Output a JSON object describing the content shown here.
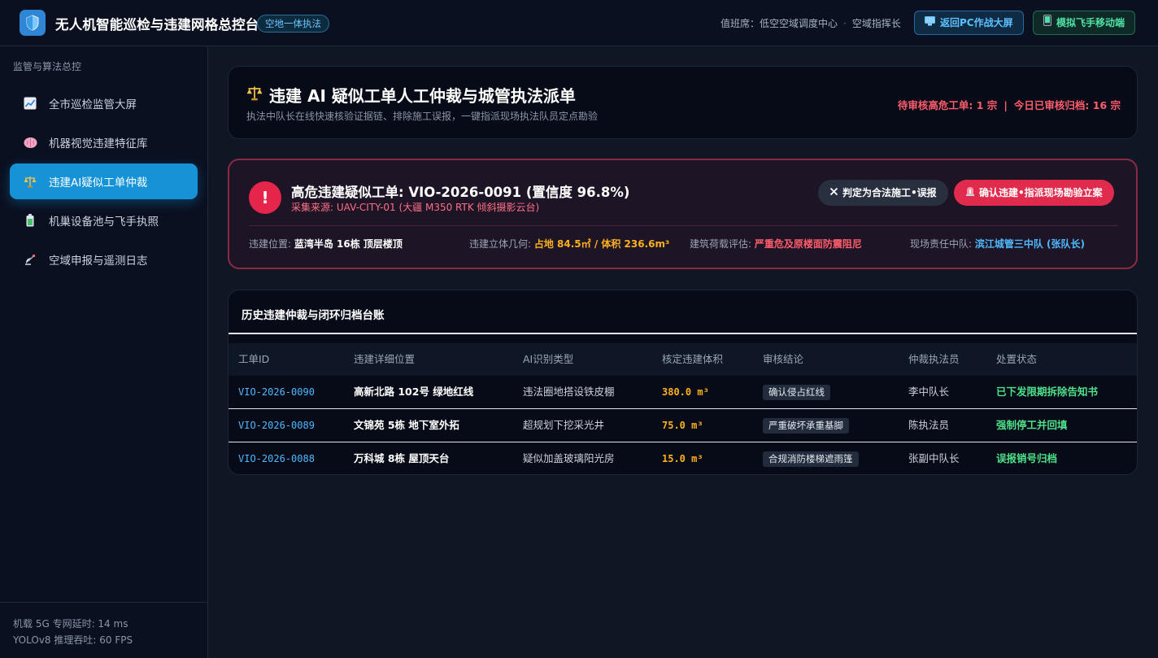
{
  "app": {
    "title": "无人机智能巡检与违建网格总控台",
    "badge": "空地一体执法",
    "duty_label": "值班席：低空空域调度中心",
    "duty_role": "空域指挥长",
    "btn_pc": "返回PC作战大屏",
    "btn_mobile": "模拟飞手移动端"
  },
  "sidebar": {
    "heading": "监管与算法总控",
    "items": [
      {
        "label": "全市巡检监管大屏",
        "icon": "chart-icon"
      },
      {
        "label": "机器视觉违建特征库",
        "icon": "brain-icon"
      },
      {
        "label": "违建AI疑似工单仲裁",
        "icon": "scales-icon",
        "active": true
      },
      {
        "label": "机巢设备池与飞手执照",
        "icon": "battery-icon"
      },
      {
        "label": "空域申报与遥测日志",
        "icon": "satellite-icon"
      }
    ],
    "footer_latency": "机载 5G 专网延时: 14 ms",
    "footer_fps": "YOLOv8 推理吞吐: 60 FPS"
  },
  "header": {
    "title": "违建 AI 疑似工单人工仲裁与城管执法派单",
    "subtitle": "执法中队长在线快速核验证据链、排除施工误报，一键指派现场执法队员定点勘验",
    "pending": "待审核高危工单: 1 宗",
    "archived": "今日已审核归档: 16 宗"
  },
  "alert": {
    "title": "高危违建疑似工单: VIO-2026-0091 (置信度 96.8%)",
    "source": "采集来源: UAV-CITY-01 (大疆 M350 RTK 倾斜摄影云台)",
    "btn_false": "判定为合法施工•误报",
    "btn_confirm": "确认违建•指派现场勘验立案",
    "fields": [
      {
        "label": "违建位置: ",
        "value": "蓝湾半岛 16栋 顶层楼顶"
      },
      {
        "label": "违建立体几何: ",
        "value": "占地 84.5㎡ / 体积 236.6m³"
      },
      {
        "label": "建筑荷载评估: ",
        "value": "严重危及原楼面防震阻尼"
      },
      {
        "label": "现场责任中队: ",
        "value": "滨江城管三中队 (张队长)"
      }
    ]
  },
  "table": {
    "title": "历史违建仲裁与闭环归档台账",
    "columns": [
      "工单ID",
      "违建详细位置",
      "AI识别类型",
      "核定违建体积",
      "审核结论",
      "仲裁执法员",
      "处置状态"
    ],
    "rows": [
      {
        "id": "VIO-2026-0090",
        "location": "高新北路 102号 绿地红线",
        "type": "违法圈地搭设铁皮棚",
        "volume": "380.0 m³",
        "verdict": "确认侵占红线",
        "officer": "李中队长",
        "status": "已下发限期拆除告知书"
      },
      {
        "id": "VIO-2026-0089",
        "location": "文锦苑 5栋 地下室外拓",
        "type": "超规划下挖采光井",
        "volume": "75.0 m³",
        "verdict": "严重破坏承重基脚",
        "officer": "陈执法员",
        "status": "强制停工并回填"
      },
      {
        "id": "VIO-2026-0088",
        "location": "万科城 8栋 屋顶天台",
        "type": "疑似加盖玻璃阳光房",
        "volume": "15.0 m³",
        "verdict": "合规消防楼梯遮雨篷",
        "officer": "张副中队长",
        "status": "误报销号归档"
      }
    ]
  }
}
